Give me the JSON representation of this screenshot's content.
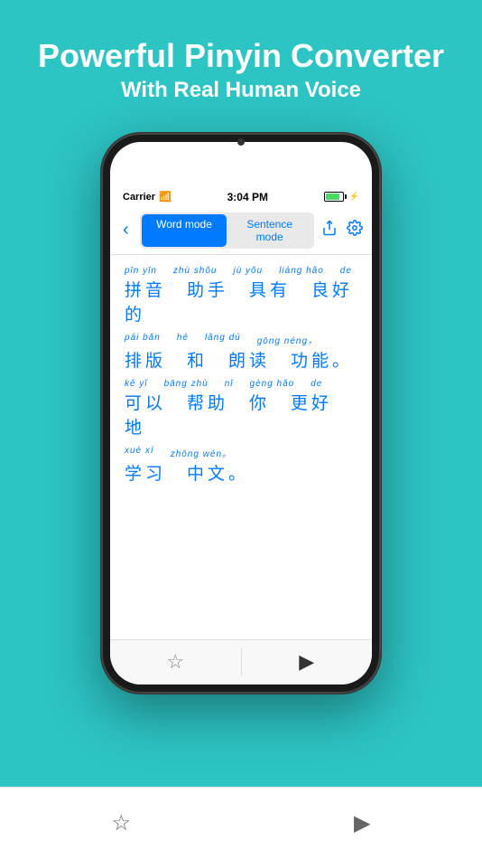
{
  "header": {
    "title_line1": "Powerful Pinyin Converter",
    "title_line2": "With Real Human Voice"
  },
  "status_bar": {
    "carrier": "Carrier",
    "time": "3:04 PM",
    "wifi": "📶"
  },
  "toolbar": {
    "back_label": "‹",
    "word_mode_label": "Word mode",
    "sentence_mode_label": "Sentence mode",
    "share_label": "⬆",
    "settings_label": "⚙"
  },
  "content": {
    "lines": [
      {
        "pinyin": "pīn yīn  zhù shǒu  jù yǒu  liáng hǎo  de",
        "chinese": "拼音    助手    具有    良好    的"
      },
      {
        "pinyin": "pái bǎn  hé  lǎng dú  gōng néng，",
        "chinese": "排版    和   朗读    功能。"
      },
      {
        "pinyin": "kě yǐ  bāng zhù  nǐ  gèng hǎo  de",
        "chinese": "可以    帮助    你   更好    地"
      },
      {
        "pinyin": "xué xí  zhōng wén。",
        "chinese": "学习    中文。"
      }
    ]
  },
  "bottom_bar": {
    "star_icon": "☆",
    "play_icon": "▶"
  },
  "app_tabs": {
    "star_label": "☆",
    "play_label": "▶"
  }
}
